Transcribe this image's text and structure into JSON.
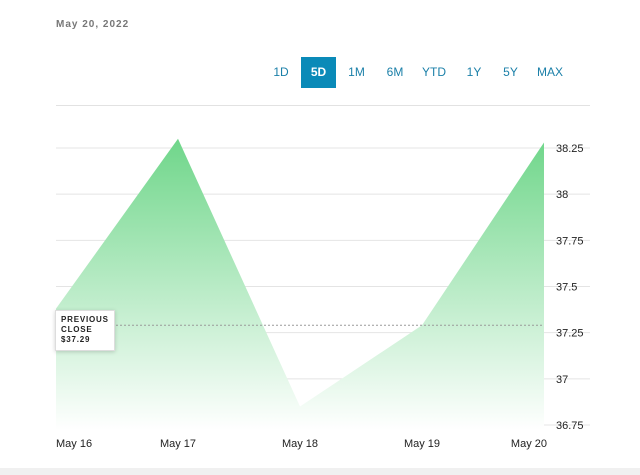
{
  "header": {
    "date": "May 20, 2022"
  },
  "range_tabs": [
    {
      "label": "1D",
      "active": false
    },
    {
      "label": "5D",
      "active": true
    },
    {
      "label": "1M",
      "active": false
    },
    {
      "label": "6M",
      "active": false
    },
    {
      "label": "YTD",
      "active": false
    },
    {
      "label": "1Y",
      "active": false
    },
    {
      "label": "5Y",
      "active": false
    },
    {
      "label": "MAX",
      "active": false
    }
  ],
  "previous_close": {
    "title_line1": "PREVIOUS",
    "title_line2": "CLOSE",
    "value": "$37.29"
  },
  "colors": {
    "accent": "#0a8ab8",
    "area_top": "#6fd68a",
    "area_bottom": "#ffffff"
  },
  "chart_data": {
    "type": "area",
    "x": [
      "May 16",
      "May 17",
      "May 18",
      "May 19",
      "May 20"
    ],
    "series": [
      {
        "values": [
          37.38,
          38.3,
          36.85,
          37.29,
          38.28
        ]
      }
    ],
    "previous_close": 37.29,
    "ylim": [
      36.75,
      38.25
    ],
    "yticks": [
      36.75,
      37,
      37.25,
      37.5,
      37.75,
      38,
      38.25
    ],
    "ytick_labels": [
      "36.75",
      "37",
      "37.25",
      "37.5",
      "37.75",
      "38",
      "38.25"
    ],
    "grid": true,
    "y_axis_side": "right"
  }
}
